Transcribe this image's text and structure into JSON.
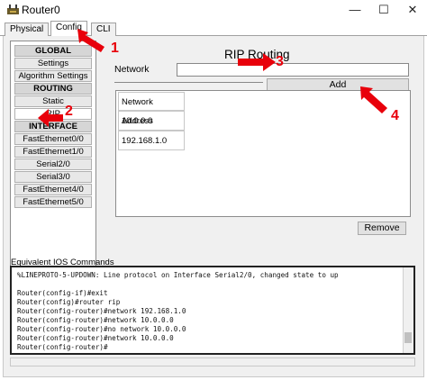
{
  "window": {
    "title": "Router0",
    "minimize_glyph": "—",
    "maximize_glyph": "☐",
    "close_glyph": "✕"
  },
  "tabs": [
    {
      "label": "Physical"
    },
    {
      "label": "Config"
    },
    {
      "label": "CLI"
    }
  ],
  "sidebar": {
    "items": [
      {
        "label": "GLOBAL",
        "type": "header"
      },
      {
        "label": "Settings"
      },
      {
        "label": "Algorithm Settings"
      },
      {
        "label": "ROUTING",
        "type": "header"
      },
      {
        "label": "Static"
      },
      {
        "label": "RIP"
      },
      {
        "label": "INTERFACE",
        "type": "header"
      },
      {
        "label": "FastEthernet0/0"
      },
      {
        "label": "FastEthernet1/0"
      },
      {
        "label": "Serial2/0"
      },
      {
        "label": "Serial3/0"
      },
      {
        "label": "FastEthernet4/0"
      },
      {
        "label": "FastEthernet5/0"
      }
    ]
  },
  "main": {
    "title": "RIP Routing",
    "network_label": "Network",
    "network_value": "",
    "add_label": "Add",
    "remove_label": "Remove",
    "address_header": "Network Address",
    "addresses": [
      "10.0.0.0",
      "192.168.1.0"
    ]
  },
  "ios": {
    "label": "Equivalent IOS Commands",
    "lines": [
      "%LINEPROTO-5-UPDOWN: Line protocol on Interface Serial2/0, changed state to up",
      "",
      "Router(config-if)#exit",
      "Router(config)#router rip",
      "Router(config-router)#network 192.168.1.0",
      "Router(config-router)#network 10.0.0.0",
      "Router(config-router)#no network 10.0.0.0",
      "Router(config-router)#network 10.0.0.0",
      "Router(config-router)#"
    ]
  },
  "annotations": {
    "color": "#e8000b",
    "steps": [
      "1",
      "2",
      "3",
      "4"
    ]
  }
}
